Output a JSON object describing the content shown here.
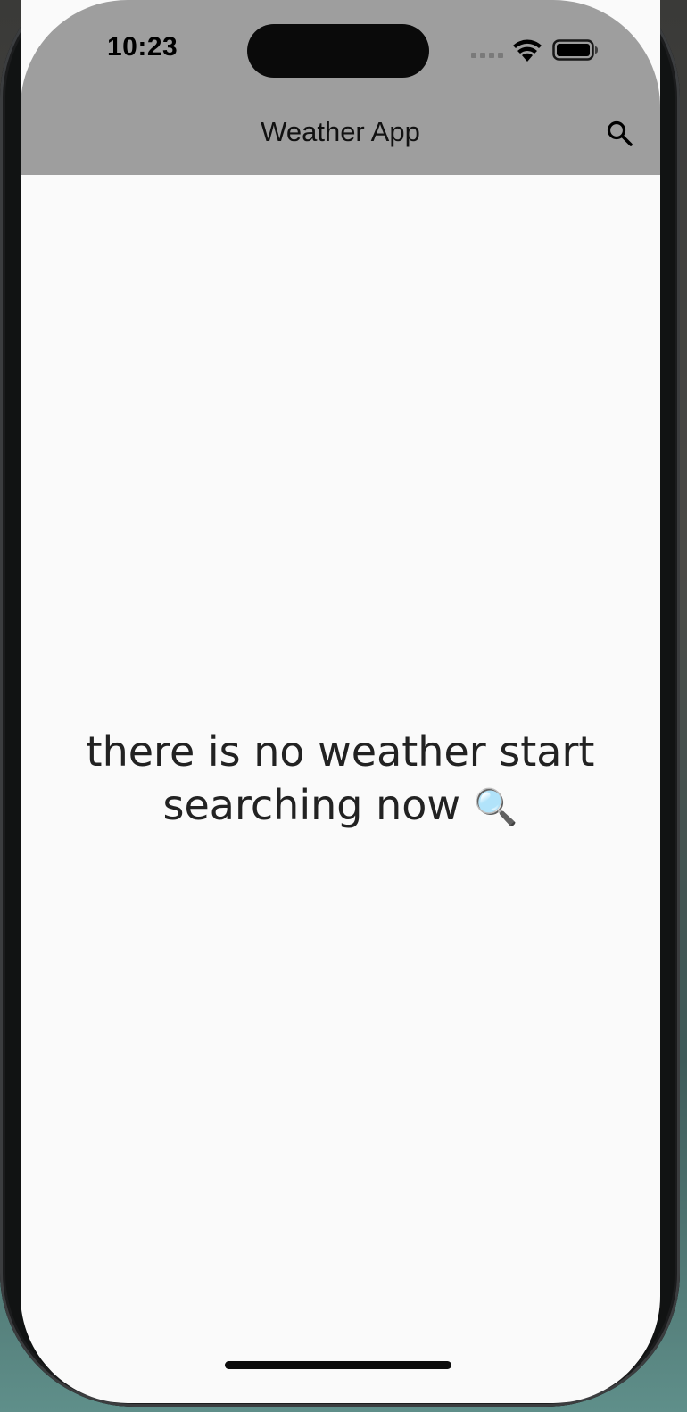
{
  "status_bar": {
    "time": "10:23"
  },
  "app_bar": {
    "title": "Weather App",
    "search_icon": "search-icon"
  },
  "body": {
    "message": "there is no weather start searching now",
    "emoji": "🔍"
  },
  "colors": {
    "app_bar": "#9e9e9e",
    "background": "#fafafa",
    "text": "#222222"
  }
}
